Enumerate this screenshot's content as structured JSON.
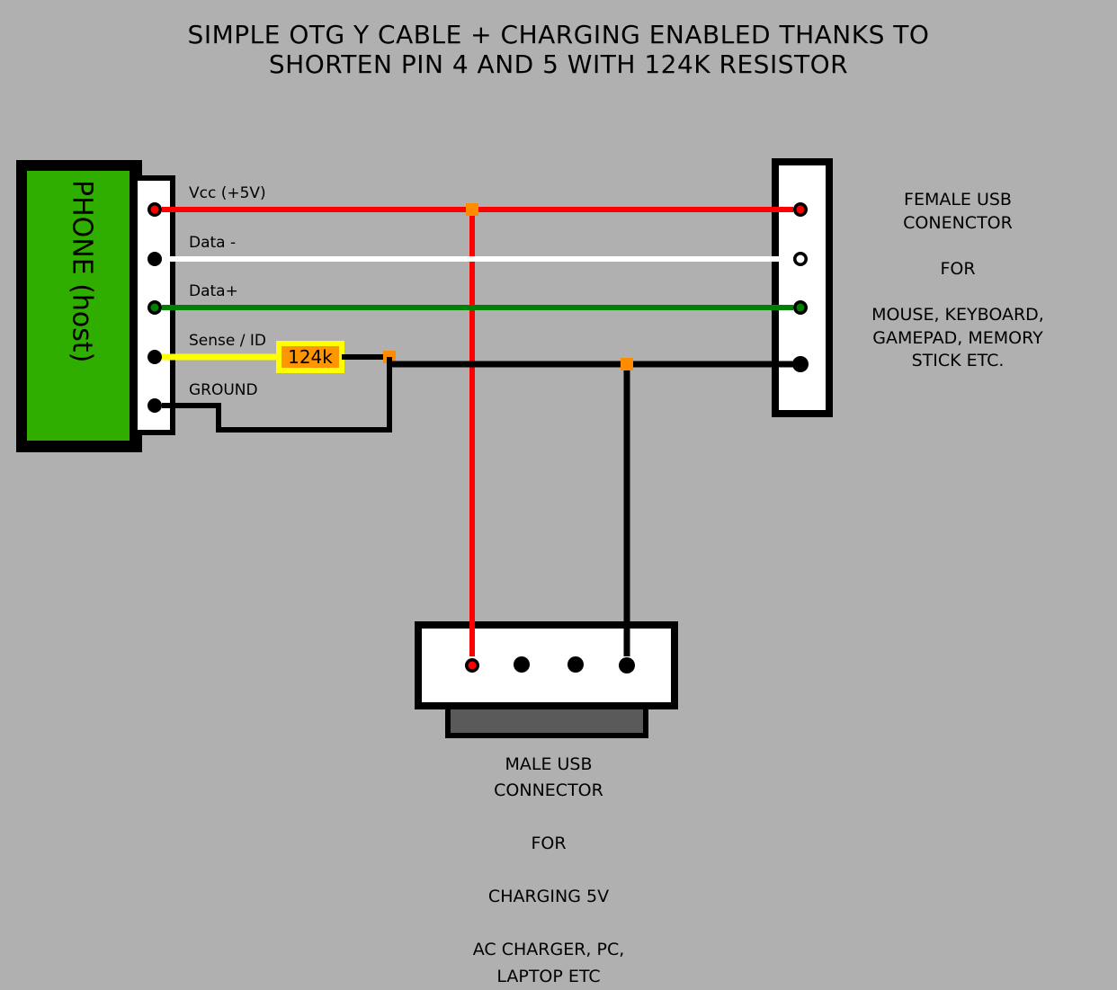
{
  "title": "SIMPLE OTG Y CABLE + CHARGING ENABLED THANKS TO\nSHORTEN PIN 4 AND 5 WITH 124K RESISTOR",
  "phone_label": "PHONE (host)",
  "wires": {
    "vcc": "Vcc (+5V)",
    "dminus": "Data -",
    "dplus": "Data+",
    "sense": "Sense / ID",
    "ground": "GROUND"
  },
  "resistor_value": "124k",
  "right_connector": {
    "line1": "FEMALE USB",
    "line2": "CONENCTOR",
    "line3": "FOR",
    "line4": "MOUSE, KEYBOARD,",
    "line5": "GAMEPAD, MEMORY",
    "line6": "STICK ETC."
  },
  "bottom_connector": {
    "line1": "MALE USB",
    "line2": "CONNECTOR",
    "line3": "FOR",
    "line4": "CHARGING 5V",
    "line5": "AC CHARGER, PC,",
    "line6": "LAPTOP ETC"
  },
  "colors": {
    "bg": "#b0b0b0",
    "green": "#2fae00",
    "red": "#ff0000",
    "white": "#ffffff",
    "wire_green": "#008000",
    "yellow": "#ffff00",
    "black": "#000000",
    "orange": "#ff8c00",
    "grey": "#5a5a5a"
  }
}
